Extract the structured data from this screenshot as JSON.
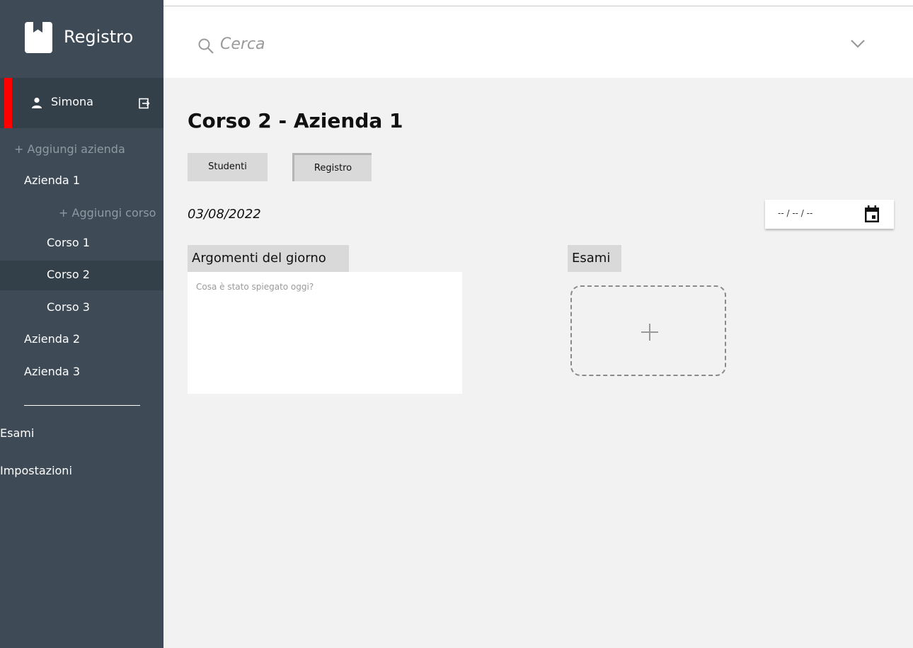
{
  "app": {
    "title": "Registro"
  },
  "sidebar": {
    "user": {
      "name": "Simona"
    },
    "add_company_label": "+ Aggiungi azienda",
    "companies": [
      {
        "label": "Azienda 1"
      },
      {
        "label": "Azienda 2"
      },
      {
        "label": "Azienda 3"
      }
    ],
    "add_course_label": "+ Aggiungi corso",
    "courses": [
      {
        "label": "Corso 1"
      },
      {
        "label": "Corso 2",
        "active": true
      },
      {
        "label": "Corso 3"
      }
    ],
    "bottom_items": [
      {
        "label": "Esami"
      },
      {
        "label": "Impostazioni"
      }
    ],
    "active_color": "#ff0000"
  },
  "search": {
    "placeholder": "Cerca"
  },
  "main": {
    "title": "Corso 2 - Azienda 1",
    "tabs": [
      {
        "label": "Studenti"
      },
      {
        "label": "Registro",
        "active": true
      }
    ],
    "date": "03/08/2022",
    "date_picker": {
      "value": "-- / -- / --"
    },
    "topics": {
      "label": "Argomenti del giorno",
      "placeholder": "Cosa è stato spiegato oggi?"
    },
    "exams": {
      "label": "Esami"
    }
  },
  "icons": {
    "logo": "bookmark-icon",
    "user": "user-icon",
    "logout": "logout-icon",
    "search": "search-icon",
    "dropdown": "chevron-down-icon",
    "calendar": "calendar-icon",
    "add": "plus-icon"
  },
  "colors": {
    "sidebar_bg": "#3e4b56",
    "sidebar_active_bg": "#344049",
    "content_bg": "#f2f2f2",
    "accent": "#ff0000"
  }
}
